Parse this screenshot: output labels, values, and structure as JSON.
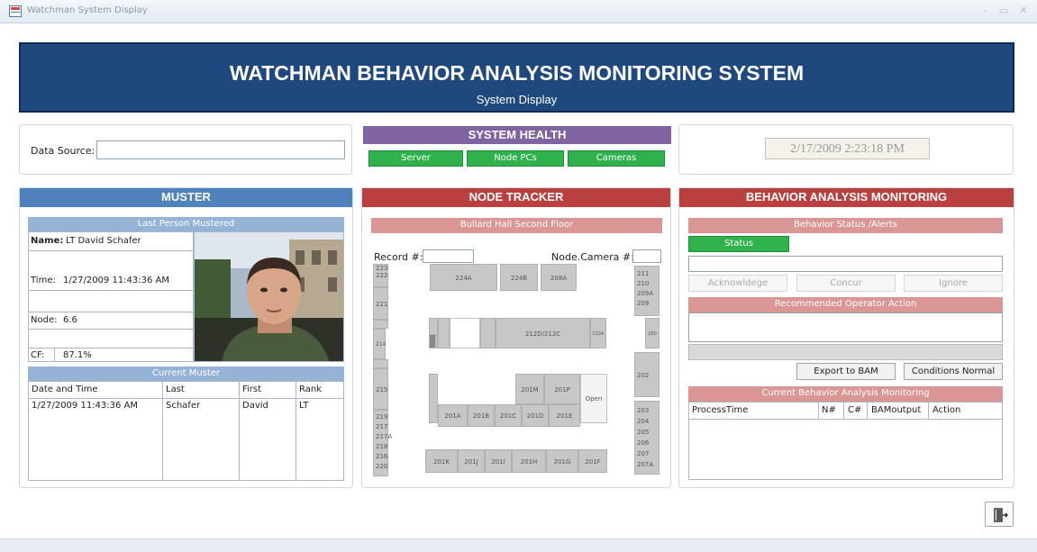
{
  "window": {
    "title": "Watchman System Display",
    "minimize": "–",
    "maximize": "▭",
    "close": "✕"
  },
  "banner": {
    "title": "WATCHMAN BEHAVIOR ANALYSIS MONITORING SYSTEM",
    "subtitle": "System Display"
  },
  "data_source": {
    "label": "Data Source:",
    "value": ""
  },
  "system_health": {
    "title": "SYSTEM HEALTH",
    "buttons": [
      "Server",
      "Node PCs",
      "Cameras"
    ]
  },
  "datetime": "2/17/2009 2:23:18 PM",
  "muster": {
    "title": "MUSTER",
    "last_person_header": "Last Person Mustered",
    "name_label": "Name:",
    "name_value": "LT David Schafer",
    "time_label": "Time:",
    "time_value": "1/27/2009 11:43:36 AM",
    "node_label": "Node:",
    "node_value": "6.6",
    "cf_label": "CF:",
    "cf_value": "87.1%",
    "current_header": "Current Muster",
    "columns": [
      "Date and Time",
      "Last",
      "First",
      "Rank"
    ],
    "rows": [
      [
        "1/27/2009 11:43:36 AM",
        "Schafer",
        "David",
        "LT"
      ]
    ]
  },
  "node_tracker": {
    "title": "NODE TRACKER",
    "floor": "Bullard Hall Second Floor",
    "record_label": "Record #:",
    "record_value": "",
    "node_camera_label": "Node.Camera #:",
    "node_camera_value": "",
    "rooms": {
      "r224a": "224A",
      "r224b": "224B",
      "r208a": "208A",
      "r223": "223",
      "r222": "222",
      "r221": "221",
      "r214": "214",
      "r215": "215",
      "r219": "219",
      "r217": "217",
      "r217a": "217A",
      "r218": "218",
      "r216": "216",
      "r220": "220",
      "r211": "211",
      "r210": "210",
      "r209a": "209A",
      "r209": "209",
      "r200": "200",
      "r202": "202",
      "r203": "203",
      "r204": "204",
      "r205": "205",
      "r206": "206",
      "r207": "207",
      "r207a": "207A",
      "r212d": "212D/212C",
      "r212a": "212A",
      "r201m": "201M",
      "r201p": "201P",
      "open": "Open",
      "r201a": "201A",
      "r201b": "201B",
      "r201c": "201C",
      "r201d": "201D",
      "r201e": "201E",
      "r201k": "201K",
      "r201j": "201J",
      "r201i": "201I",
      "r201h": "201H",
      "r201g": "201G",
      "r201f": "201F"
    }
  },
  "bam": {
    "title": "BEHAVIOR ANALYSIS MONITORING",
    "alerts_header": "Behavior Status /Alerts",
    "status_button": "Status",
    "acknowledge": "Acknowldege",
    "concur": "Concur",
    "ignore": "Ignore",
    "recommended_header": "Recommended Operator Action",
    "export_button": "Export to BAM",
    "conditions_button": "Conditions Normal",
    "current_header": "Current Behavior Analysis Monitoring",
    "columns": [
      "ProcessTime",
      "N#",
      "C#",
      "BAMoutput",
      "Action"
    ]
  },
  "colors": {
    "banner": "#1f487e",
    "muster": "#4f81bd",
    "system_health": "#8064a2",
    "node_tracker": "#b9403e",
    "node_sub": "#d99694",
    "status_green": "#2fb24b"
  },
  "exit_icon": "exit-door-icon"
}
